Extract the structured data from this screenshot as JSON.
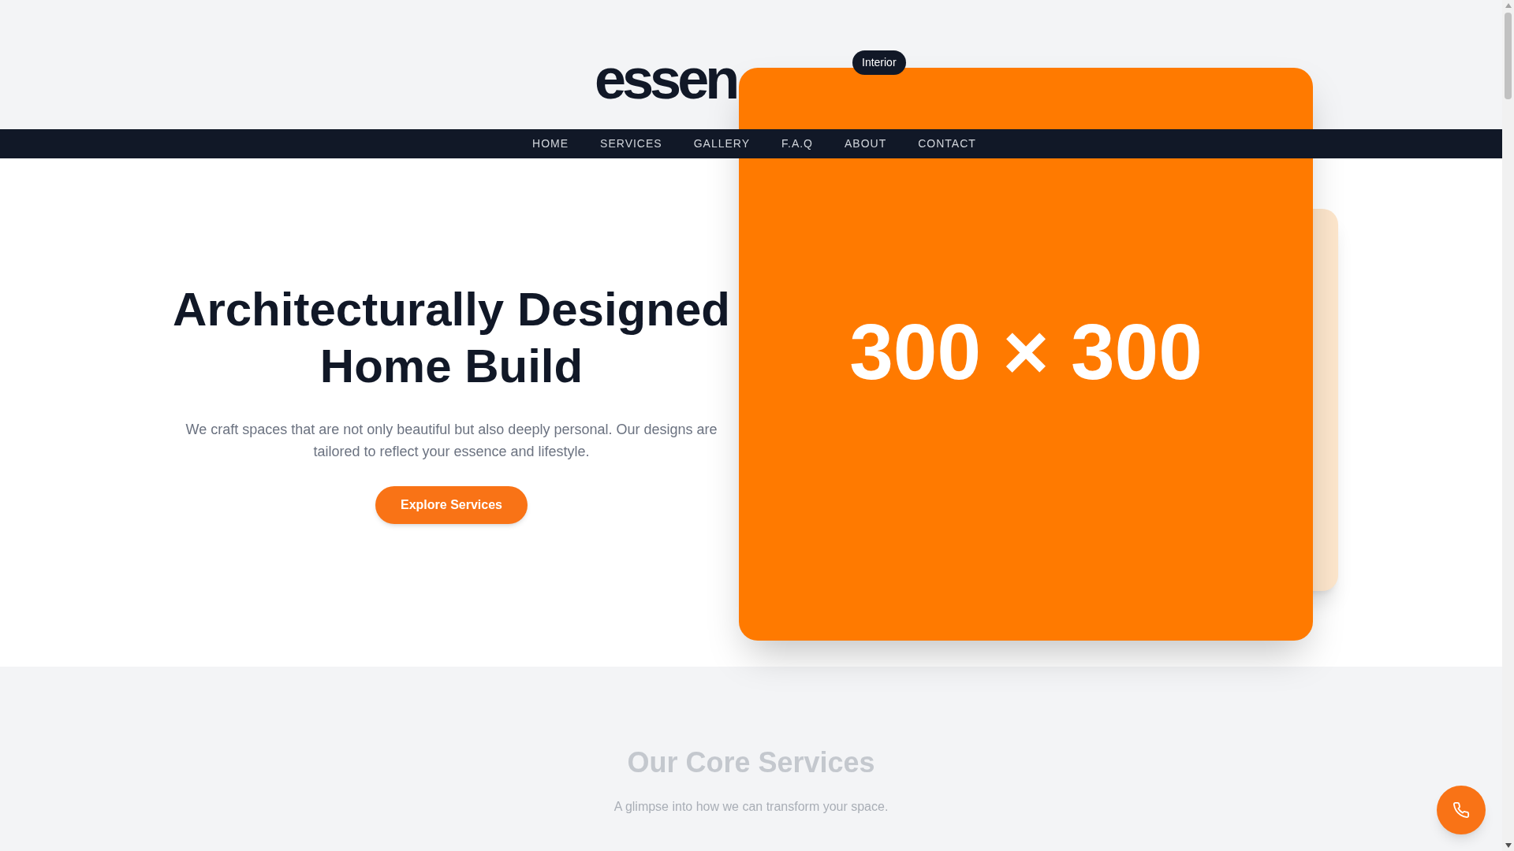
{
  "header": {
    "logo": "essen",
    "badge": "Interior"
  },
  "nav": [
    {
      "label": "HOME"
    },
    {
      "label": "SERVICES"
    },
    {
      "label": "GALLERY"
    },
    {
      "label": "F.A.Q"
    },
    {
      "label": "ABOUT"
    },
    {
      "label": "CONTACT"
    }
  ],
  "hero": {
    "title_lines": [
      "Architecturally Designed",
      "Home Build"
    ],
    "text": "We craft spaces that are not only beautiful but also deeply personal. Our designs are tailored to reflect your essence and lifestyle.",
    "button": "Explore Services",
    "image_placeholder": "300 × 300"
  },
  "services": {
    "title": "Our Core Services",
    "subtitle": "A glimpse into how we can transform your space."
  }
}
